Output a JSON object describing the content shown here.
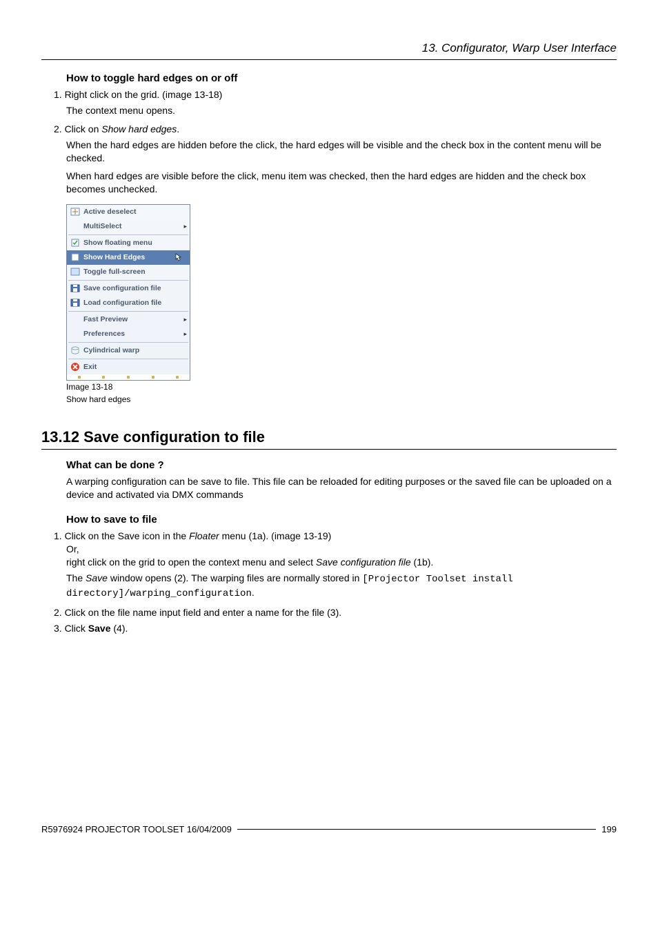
{
  "header": {
    "chapter_title": "13. Configurator, Warp User Interface"
  },
  "section1": {
    "heading": "How to toggle hard edges on or off",
    "step1": "1. Right click on the grid. (image 13-18)",
    "step1_sub": "The context menu opens.",
    "step2_prefix": "2. Click on ",
    "step2_em": "Show hard edges",
    "step2_suffix": ".",
    "step2_sub1": "When the hard edges are hidden before the click, the hard edges will be visible and the check box in the content menu will be checked.",
    "step2_sub2": "When hard edges are visible before the click, menu item was checked, then the hard edges are hidden and the check box becomes unchecked."
  },
  "menu": {
    "items": {
      "active_deselect": "Active deselect",
      "multiselect": "MultiSelect",
      "show_floating_menu": "Show floating menu",
      "show_hard_edges": "Show Hard Edges",
      "toggle_full_screen": "Toggle full-screen",
      "save_config": "Save configuration file",
      "load_config": "Load configuration file",
      "fast_preview": "Fast Preview",
      "preferences": "Preferences",
      "cylindrical_warp": "Cylindrical warp",
      "exit": "Exit"
    },
    "caption_line1": "Image 13-18",
    "caption_line2": "Show hard edges"
  },
  "section2": {
    "heading_full": "13.12 Save configuration to file",
    "sub1_heading": "What can be done ?",
    "sub1_para": "A warping configuration can be save to file. This file can be reloaded for editing purposes or the saved file can be uploaded on a device and activated via DMX commands",
    "sub2_heading": "How to save to file",
    "step1_prefix": "1. Click on the Save icon in the ",
    "step1_em": "Floater",
    "step1_mid": " menu (1a). (image 13-19)",
    "step1_or": "Or,",
    "step1_line2_prefix": "right click on the grid to open the context menu and select ",
    "step1_line2_em": "Save configuration file",
    "step1_line2_suffix": " (1b).",
    "step1_result_prefix": "The ",
    "step1_result_em": "Save",
    "step1_result_mid": " window opens (2). The warping files are normally stored in ",
    "step1_result_code": "[Projector Toolset install directory]/warping_configuration",
    "step1_result_suffix": ".",
    "step2": "2. Click on the file name input field and enter a name for the file (3).",
    "step3_prefix": "3. Click ",
    "step3_bold": "Save",
    "step3_suffix": " (4)."
  },
  "footer": {
    "left": "R5976924 PROJECTOR TOOLSET 16/04/2009",
    "right": "199"
  }
}
